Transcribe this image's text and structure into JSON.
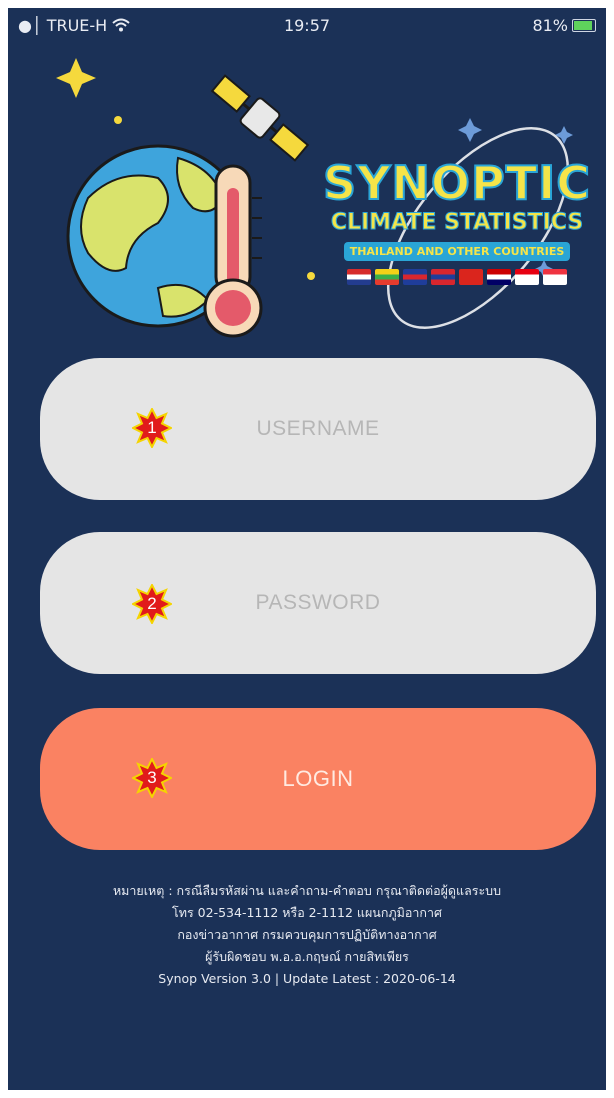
{
  "status_bar": {
    "carrier": "TRUE-H",
    "time": "19:57",
    "battery": "81%"
  },
  "header": {
    "title_line1": "SYNOPTIC",
    "title_line2": "CLIMATE STATISTICS",
    "title_line3": "THAILAND AND OTHER COUNTRIES",
    "flags": [
      {
        "name": "thailand-flag",
        "colors": [
          "#d62b2b",
          "#ffffff",
          "#233c8f"
        ]
      },
      {
        "name": "myanmar-flag",
        "colors": [
          "#f4d118",
          "#3bb04a",
          "#e53b2e"
        ]
      },
      {
        "name": "cambodia-flag",
        "colors": [
          "#1f3d9a",
          "#d8262e",
          "#1f3d9a"
        ]
      },
      {
        "name": "laos-flag",
        "colors": [
          "#d8262e",
          "#1f3d9a",
          "#d8262e"
        ]
      },
      {
        "name": "vietnam-flag",
        "colors": [
          "#da251d",
          "#da251d",
          "#da251d"
        ]
      },
      {
        "name": "malaysia-flag",
        "colors": [
          "#cc0001",
          "#ffffff",
          "#010066"
        ]
      },
      {
        "name": "indonesia-flag",
        "colors": [
          "#e70011",
          "#ffffff",
          "#ffffff"
        ]
      },
      {
        "name": "singapore-flag",
        "colors": [
          "#ef3340",
          "#ffffff",
          "#ffffff"
        ]
      }
    ]
  },
  "form": {
    "username_placeholder": "USERNAME",
    "password_placeholder": "PASSWORD",
    "login_label": "LOGIN"
  },
  "badges": {
    "one": "1",
    "two": "2",
    "three": "3"
  },
  "footer": {
    "line1": "หมายเหตุ : กรณีลืมรหัสผ่าน และคำถาม-คำตอบ กรุณาติดต่อผู้ดูแลระบบ",
    "line2": "โทร 02-534-1112 หรือ 2-1112 แผนกภูมิอากาศ",
    "line3": "กองข่าวอากาศ กรมควบคุมการปฏิบัติทางอากาศ",
    "line4": "ผู้รับผิดชอบ พ.อ.อ.กฤษณ์ กายสิทเพียร",
    "line5": "Synop Version 3.0 | Update Latest : 2020-06-14"
  },
  "colors": {
    "background": "#1b3157",
    "field": "#e5e5e5",
    "login_button": "#fa8262",
    "title_yellow": "#f5e449",
    "title_outline": "#2aa5d6"
  }
}
